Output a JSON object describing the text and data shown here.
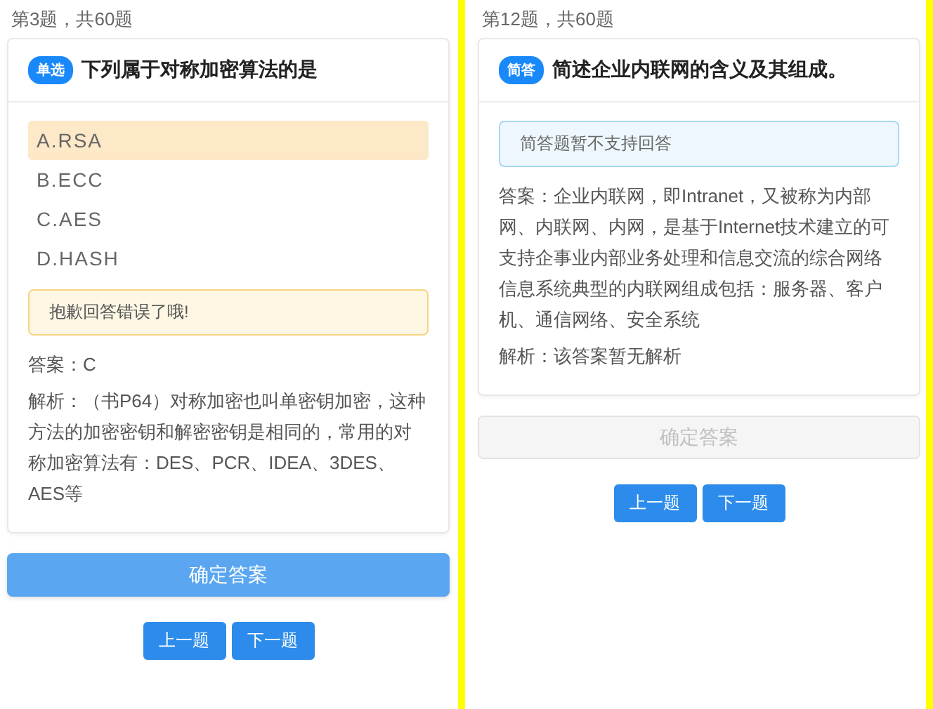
{
  "panels": [
    {
      "progress": "第3题，共60题",
      "question": {
        "tag": "单选",
        "title": "下列属于对称加密算法的是"
      },
      "options": [
        {
          "label": "A.RSA",
          "selected": true
        },
        {
          "label": "B.ECC",
          "selected": false
        },
        {
          "label": "C.AES",
          "selected": false
        },
        {
          "label": "D.HASH",
          "selected": false
        }
      ],
      "notice": {
        "kind": "error",
        "text": "抱歉回答错误了哦!"
      },
      "answer": "答案：C",
      "analysis": "解析：（书P64）对称加密也叫单密钥加密，这种方法的加密密钥和解密密钥是相同的，常用的对称加密算法有：DES、PCR、IDEA、3DES、AES等",
      "confirm": {
        "label": "确定答案",
        "disabled": false
      },
      "nav": [
        "上一题",
        "下一题"
      ]
    },
    {
      "progress": "第12题，共60题",
      "question": {
        "tag": "简答",
        "title": "简述企业内联网的含义及其组成。"
      },
      "notice": {
        "kind": "info",
        "text": "简答题暂不支持回答"
      },
      "answer": "答案：企业内联网，即Intranet，又被称为内部网、内联网、内网，是基于Internet技术建立的可支持企事业内部业务处理和信息交流的综合网络信息系统典型的内联网组成包括：服务器、客户机、通信网络、安全系统",
      "analysis": "解析：该答案暂无解析",
      "confirm": {
        "label": "确定答案",
        "disabled": true
      },
      "nav": [
        "上一题",
        "下一题"
      ]
    }
  ]
}
